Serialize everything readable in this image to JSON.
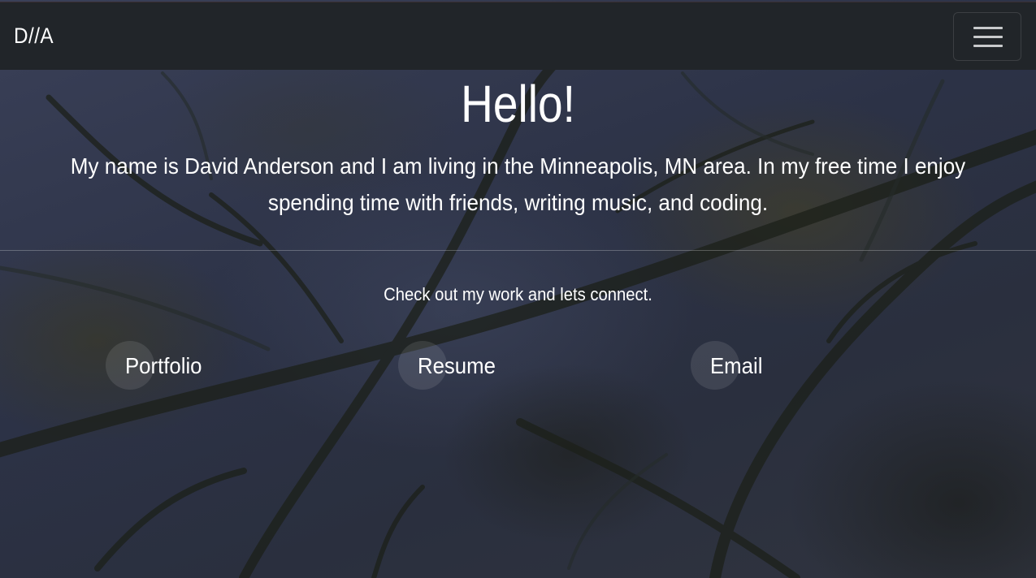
{
  "navbar": {
    "brand": "D//A",
    "toggler_icon": "hamburger-menu-icon"
  },
  "hero": {
    "title": "Hello!",
    "intro": "My name is David Anderson and I am living in the Minneapolis, MN area. In my free time I enjoy spending time with friends, writing music, and coding."
  },
  "cta": {
    "text": "Check out my work and lets connect."
  },
  "links": [
    {
      "label": "Portfolio"
    },
    {
      "label": "Resume"
    },
    {
      "label": "Email"
    }
  ]
}
